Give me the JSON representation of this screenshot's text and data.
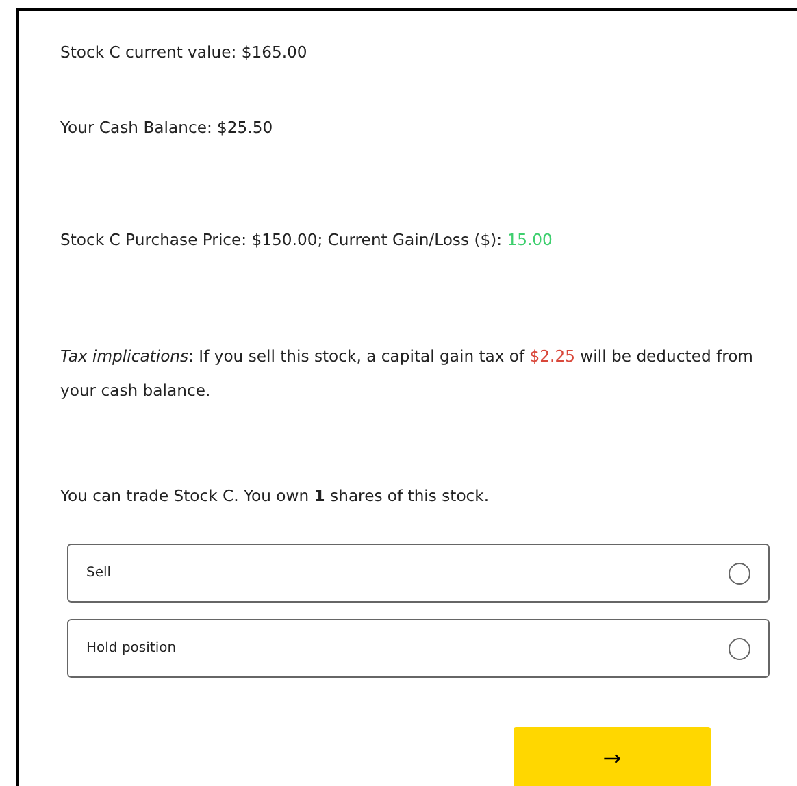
{
  "info_lines": [
    {
      "segments": [
        {
          "text": "Stock C current value: $165.00"
        }
      ]
    },
    {
      "segments": [
        {
          "text": "Your Cash Balance: $25.50"
        }
      ]
    },
    {
      "segments": [
        {
          "text": "Stock C Purchase Price: $150.00; Current Gain/Loss ($): "
        },
        {
          "text": "15.00",
          "color": "#3ecf6e"
        }
      ]
    },
    {
      "segments": [
        {
          "text": "*Tax implications*: If you sell this stock, a capital gain tax of "
        },
        {
          "text": "$2.25",
          "color": "#d9473a"
        },
        {
          "text": " will be deducted from your cash balance."
        }
      ]
    }
  ],
  "question": "You can trade Stock C. You own **1** shares of this stock.",
  "options": [
    {
      "label": "Sell",
      "selected": false
    },
    {
      "label": "Hold position",
      "selected": false
    }
  ],
  "next_button": {
    "label": "→"
  }
}
